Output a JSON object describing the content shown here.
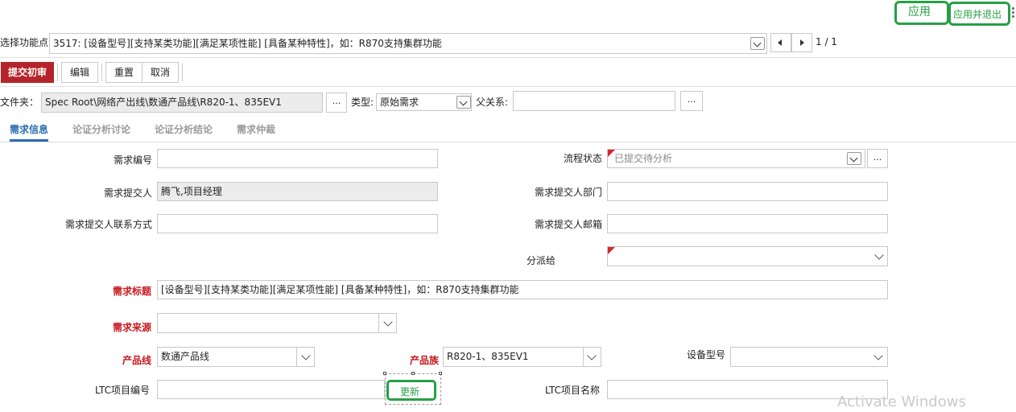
{
  "toolbar_top": {
    "apply": "应用",
    "apply_exit": "应用并退出"
  },
  "feature_row": {
    "label": "选择功能点:",
    "value": "3517: [设备型号][支持某类功能][满足某项性能] [具备某种特性]，如：R870支持集群功能",
    "page_indicator": "1 / 1"
  },
  "actions": {
    "submit": "提交初审",
    "edit": "编辑",
    "reset": "重置",
    "cancel": "取消"
  },
  "folder_row": {
    "folder_label": "文件夹：",
    "folder_value": "Spec Root\\网络产出线\\数通产品线\\R820-1、835EV1",
    "browse": "...",
    "type_label": "类型:",
    "type_value": "原始需求",
    "parent_label": "父关系:",
    "parent_browse": "..."
  },
  "tabs": [
    {
      "label": "需求信息",
      "active": true
    },
    {
      "label": "论证分析讨论",
      "active": false
    },
    {
      "label": "论证分析结论",
      "active": false
    },
    {
      "label": "需求仲裁",
      "active": false
    }
  ],
  "form": {
    "req_no_label": "需求编号",
    "req_no_value": "",
    "flow_status_label": "流程状态",
    "flow_status_value": "已提交待分析",
    "flow_status_browse": "...",
    "submitter_label": "需求提交人",
    "submitter_value": "腾飞,项目经理",
    "submitter_dept_label": "需求提交人部门",
    "submitter_contact_label": "需求提交人联系方式",
    "submitter_email_label": "需求提交人邮箱",
    "assign_label": "分派给",
    "title_label": "需求标题",
    "title_value": "[设备型号][支持某类功能][满足某项性能] [具备某种特性]，如：R870支持集群功能",
    "source_label": "需求来源",
    "product_line_label": "产品线",
    "product_line_value": "数通产品线",
    "product_family_label": "产品族",
    "product_family_value": "R820-1、835EV1",
    "device_model_label": "设备型号",
    "ltc_no_label": "LTC项目编号",
    "update_button": "更新",
    "ltc_name_label": "LTC项目名称"
  },
  "watermark": "Activate Windows",
  "colors": {
    "submit_bg": "#b5242a",
    "highlight": "#27a045",
    "active_tab": "#2a6db5",
    "required_label": "#c8191f"
  }
}
